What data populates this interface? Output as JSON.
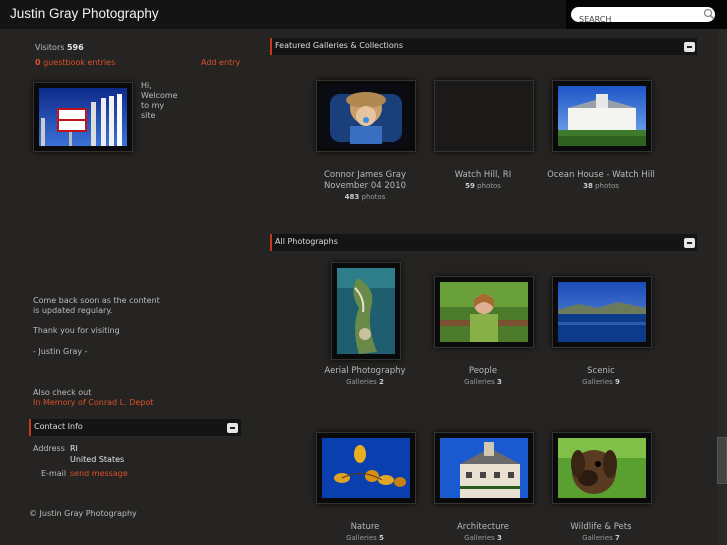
{
  "header": {
    "title": "Justin Gray Photography"
  },
  "search": {
    "placeholder": "SEARCH"
  },
  "sidebar": {
    "visitors_label": "Visitors",
    "visitors_count": "596",
    "guestbook_count": "0",
    "guestbook_label": "guestbook entries",
    "add_entry": "Add entry",
    "welcome": [
      "Hi,",
      "Welcome",
      "to my",
      "site"
    ],
    "message_lines": [
      "Come back soon as the content",
      "is updated regulary."
    ],
    "thanks": "Thank you for visiting",
    "signature": "- Justin Gray -",
    "also_check": "Also check out",
    "memorial_link": "In Memory of Conrad L. Depot",
    "contact_header": "Contact Info",
    "address_label": "Address",
    "address_line1": "RI",
    "address_line2": "United States",
    "email_label": "E-mail",
    "email_link": "send message",
    "copyright": "© Justin Gray Photography"
  },
  "featured": {
    "header": "Featured Galleries & Collections",
    "items": [
      {
        "title1": "Connor James Gray",
        "title2": "November 04 2010",
        "count": "483",
        "unit": "photos"
      },
      {
        "title1": "Watch Hill, RI",
        "count": "59",
        "unit": "photos"
      },
      {
        "title1": "Ocean House - Watch Hill",
        "count": "38",
        "unit": "photos"
      }
    ]
  },
  "all_photos": {
    "header": "All Photographs",
    "items": [
      {
        "title": "Aerial Photography",
        "label": "Galleries",
        "count": "2"
      },
      {
        "title": "People",
        "label": "Galleries",
        "count": "3"
      },
      {
        "title": "Scenic",
        "label": "Galleries",
        "count": "9"
      },
      {
        "title": "Nature",
        "label": "Galleries",
        "count": "5"
      },
      {
        "title": "Architecture",
        "label": "Galleries",
        "count": "3"
      },
      {
        "title": "Wildlife & Pets",
        "label": "Galleries",
        "count": "7"
      }
    ]
  },
  "colors": {
    "accent": "#d9502a",
    "background": "#262422",
    "header_bg": "#141414"
  }
}
